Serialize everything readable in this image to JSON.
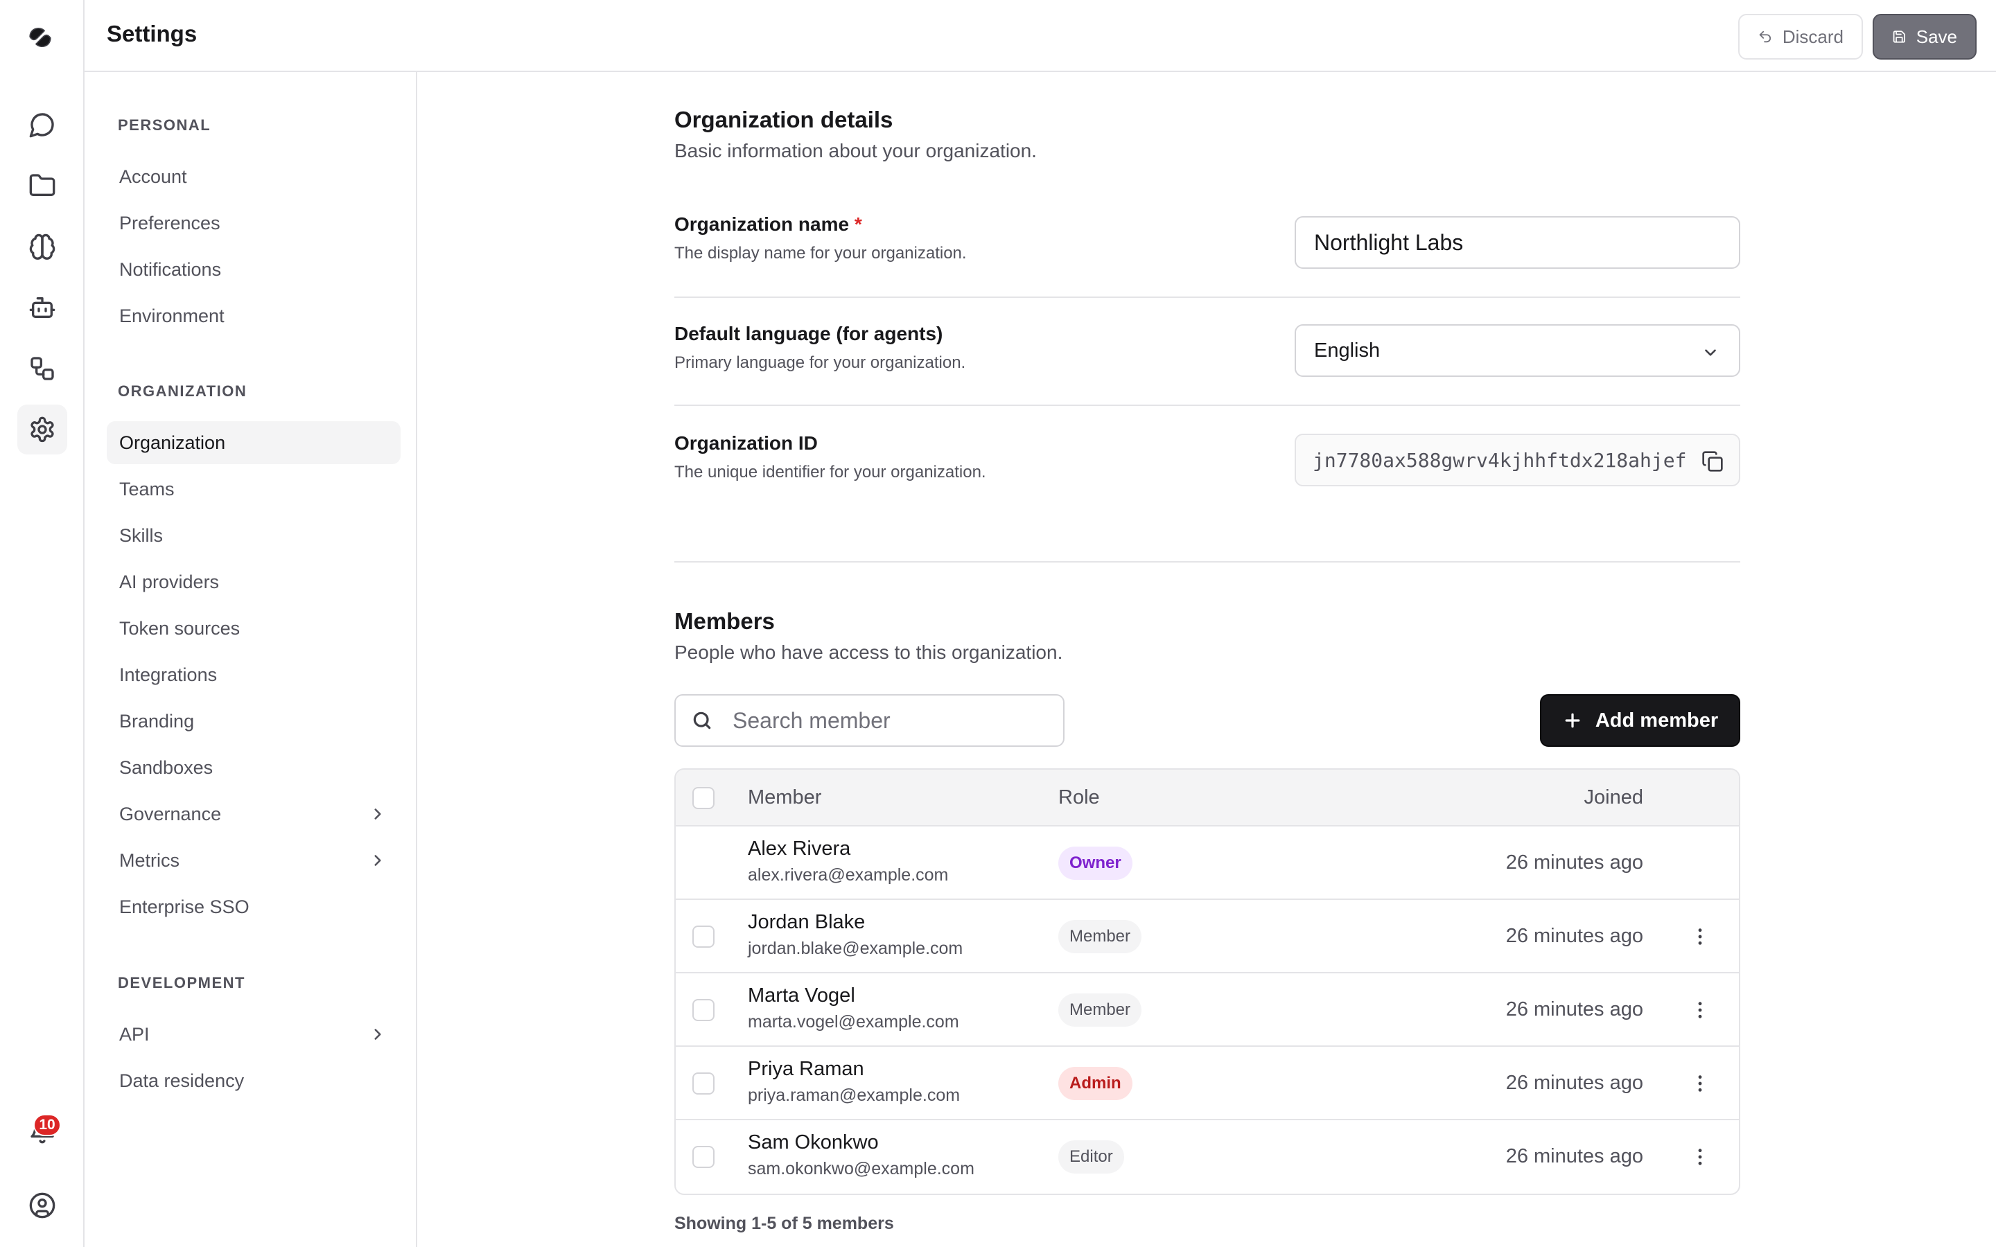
{
  "header": {
    "title": "Settings",
    "discard_label": "Discard",
    "save_label": "Save"
  },
  "rail": {
    "notifications_count": "10"
  },
  "nav": {
    "personal_heading": "PERSONAL",
    "personal": [
      "Account",
      "Preferences",
      "Notifications",
      "Environment"
    ],
    "organization_heading": "ORGANIZATION",
    "organization": [
      "Organization",
      "Teams",
      "Skills",
      "AI providers",
      "Token sources",
      "Integrations",
      "Branding",
      "Sandboxes",
      "Governance",
      "Metrics",
      "Enterprise SSO"
    ],
    "development_heading": "DEVELOPMENT",
    "development": [
      "API",
      "Data residency"
    ],
    "active": "Organization"
  },
  "org_details": {
    "title": "Organization details",
    "subtitle": "Basic information about your organization.",
    "name_label": "Organization name",
    "name_required": "*",
    "name_desc": "The display name for your organization.",
    "name_value": "Northlight Labs",
    "language_label": "Default language (for agents)",
    "language_desc": "Primary language for your organization.",
    "language_value": "English",
    "id_label": "Organization ID",
    "id_desc": "The unique identifier for your organization.",
    "id_value": "jn7780ax588gwrv4kjhhftdx218ahjef"
  },
  "members": {
    "title": "Members",
    "subtitle": "People who have access to this organization.",
    "search_placeholder": "Search member",
    "add_label": "Add member",
    "columns": {
      "member": "Member",
      "role": "Role",
      "joined": "Joined"
    },
    "rows": [
      {
        "name": "Alex Rivera",
        "email": "alex.rivera@example.com",
        "role": "Owner",
        "joined": "26 minutes ago"
      },
      {
        "name": "Jordan Blake",
        "email": "jordan.blake@example.com",
        "role": "Member",
        "joined": "26 minutes ago"
      },
      {
        "name": "Marta Vogel",
        "email": "marta.vogel@example.com",
        "role": "Member",
        "joined": "26 minutes ago"
      },
      {
        "name": "Priya Raman",
        "email": "priya.raman@example.com",
        "role": "Admin",
        "joined": "26 minutes ago"
      },
      {
        "name": "Sam Okonkwo",
        "email": "sam.okonkwo@example.com",
        "role": "Editor",
        "joined": "26 minutes ago"
      }
    ],
    "footer": "Showing 1-5 of 5 members"
  }
}
